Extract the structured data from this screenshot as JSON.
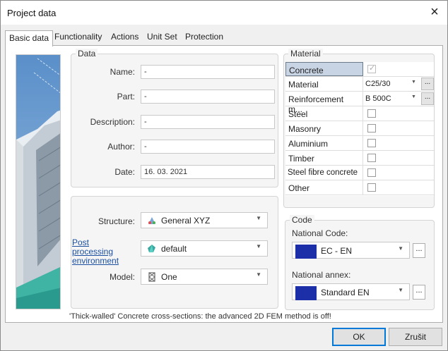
{
  "window": {
    "title": "Project data",
    "close": "×"
  },
  "tabs": [
    {
      "label": "Basic data",
      "active": true
    },
    {
      "label": "Functionality",
      "active": false
    },
    {
      "label": "Actions",
      "active": false
    },
    {
      "label": "Unit Set",
      "active": false
    },
    {
      "label": "Protection",
      "active": false
    }
  ],
  "data_group": {
    "title": "Data",
    "fields": [
      {
        "label": "Name:",
        "value": "-"
      },
      {
        "label": "Part:",
        "value": "-"
      },
      {
        "label": "Description:",
        "value": "-"
      },
      {
        "label": "Author:",
        "value": "-"
      },
      {
        "label": "Date:",
        "value": "16. 03. 2021"
      }
    ]
  },
  "structure_group": {
    "structure_label": "Structure:",
    "structure_value": "General XYZ",
    "post_processing_label": "Post processing environment",
    "post_processing_value": "default",
    "model_label": "Model:",
    "model_value": "One"
  },
  "material_group": {
    "title": "Material",
    "rows": [
      {
        "name": "Concrete",
        "type": "checkbox",
        "checked": true,
        "selected": true
      },
      {
        "name": "Material",
        "type": "select",
        "value": "C25/30"
      },
      {
        "name": "Reinforcement m...",
        "type": "select",
        "value": "B 500C"
      },
      {
        "name": "Steel",
        "type": "checkbox",
        "checked": false
      },
      {
        "name": "Masonry",
        "type": "checkbox",
        "checked": false
      },
      {
        "name": "Aluminium",
        "type": "checkbox",
        "checked": false
      },
      {
        "name": "Timber",
        "type": "checkbox",
        "checked": false
      },
      {
        "name": "Steel fibre concrete",
        "type": "checkbox",
        "checked": false
      },
      {
        "name": "Other",
        "type": "checkbox",
        "checked": false
      }
    ]
  },
  "code_group": {
    "title": "Code",
    "national_code_label": "National Code:",
    "national_code_value": "EC - EN",
    "national_annex_label": "National annex:",
    "national_annex_value": "Standard EN",
    "ellipsis": "..."
  },
  "footnote": "'Thick-walled' Concrete cross-sections: the advanced 2D FEM method is off!",
  "buttons": {
    "ok": "OK",
    "cancel": "Zrušit"
  },
  "colors": {
    "accent": "#0078d7",
    "selected_row": "#c8d4e4",
    "flag_blue": "#1d2fa8",
    "link": "#1a4fa0"
  }
}
